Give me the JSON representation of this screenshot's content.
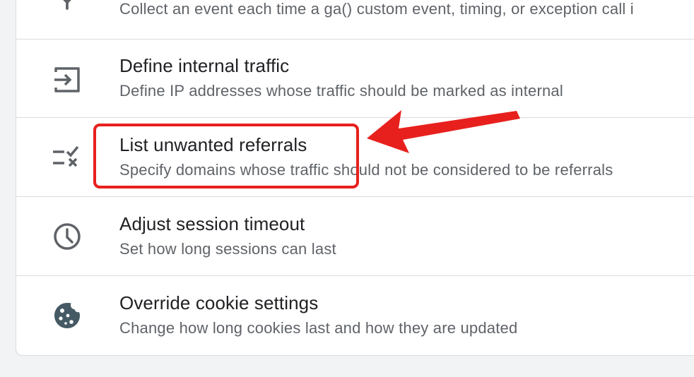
{
  "settings_list": {
    "items": [
      {
        "icon": "tag-icon",
        "title": "",
        "description": "Collect an event each time a ga() custom event, timing, or exception call i"
      },
      {
        "icon": "internal-traffic-icon",
        "title": "Define internal traffic",
        "description": "Define IP addresses whose traffic should be marked as internal"
      },
      {
        "icon": "unwanted-referrals-icon",
        "title": "List unwanted referrals",
        "description": "Specify domains whose traffic should not be considered to be referrals"
      },
      {
        "icon": "clock-icon",
        "title": "Adjust session timeout",
        "description": "Set how long sessions can last"
      },
      {
        "icon": "cookie-icon",
        "title": "Override cookie settings",
        "description": "Change how long cookies last and how they are updated"
      }
    ]
  },
  "annotation": {
    "color": "#e8201d"
  }
}
